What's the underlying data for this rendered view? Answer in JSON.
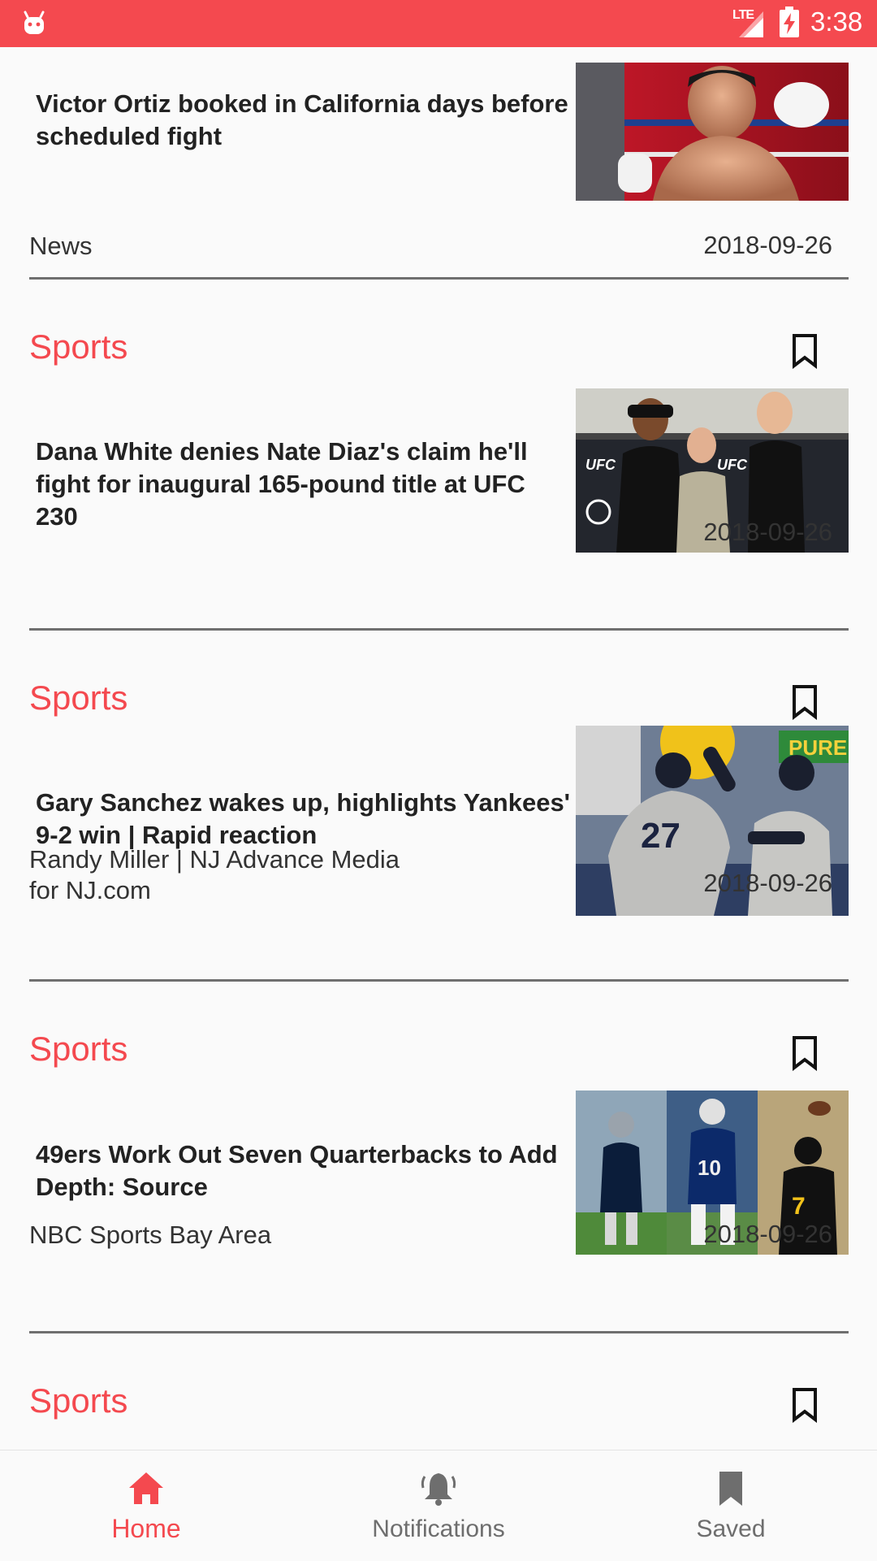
{
  "status_bar": {
    "network": "LTE",
    "time": "3:38",
    "icons": [
      "android-app-icon",
      "signal-icon",
      "battery-charging-icon"
    ],
    "color": "#f4494f"
  },
  "feed": {
    "accent_color": "#f4494f",
    "cards": [
      {
        "category": "",
        "headline": "Victor Ortiz booked in California days before scheduled fight",
        "source": "News",
        "date": "2018-09-26",
        "bookmark_icon": "bookmark-outline-icon",
        "image": "boxer-photo"
      },
      {
        "category": "Sports",
        "headline": "Dana White denies Nate Diaz's claim he'll fight for inaugural 165-pound title at UFC 230",
        "source": "",
        "date": "2018-09-26",
        "bookmark_icon": "bookmark-outline-icon",
        "image": "ufc-faceoff-photo"
      },
      {
        "category": "Sports",
        "headline": "Gary Sanchez wakes up, highlights Yankees' 9-2 win | Rapid reaction",
        "source": "Randy Miller | NJ Advance Media for NJ.com",
        "date": "2018-09-26",
        "bookmark_icon": "bookmark-outline-icon",
        "image": "yankees-photo"
      },
      {
        "category": "Sports",
        "headline": "49ers Work Out Seven Quarterbacks to Add Depth: Source",
        "source": "NBC Sports Bay Area",
        "date": "2018-09-26",
        "bookmark_icon": "bookmark-outline-icon",
        "image": "quarterbacks-collage-photo"
      },
      {
        "category": "Sports",
        "headline": "",
        "source": "",
        "date": "",
        "bookmark_icon": "bookmark-outline-icon",
        "image": ""
      }
    ]
  },
  "bottom_nav": {
    "items": [
      {
        "label": "Home",
        "icon": "home-icon",
        "active": true
      },
      {
        "label": "Notifications",
        "icon": "bell-icon",
        "active": false
      },
      {
        "label": "Saved",
        "icon": "bookmark-filled-icon",
        "active": false
      }
    ],
    "active_color": "#f4494f",
    "inactive_color": "#6e6e6e"
  }
}
